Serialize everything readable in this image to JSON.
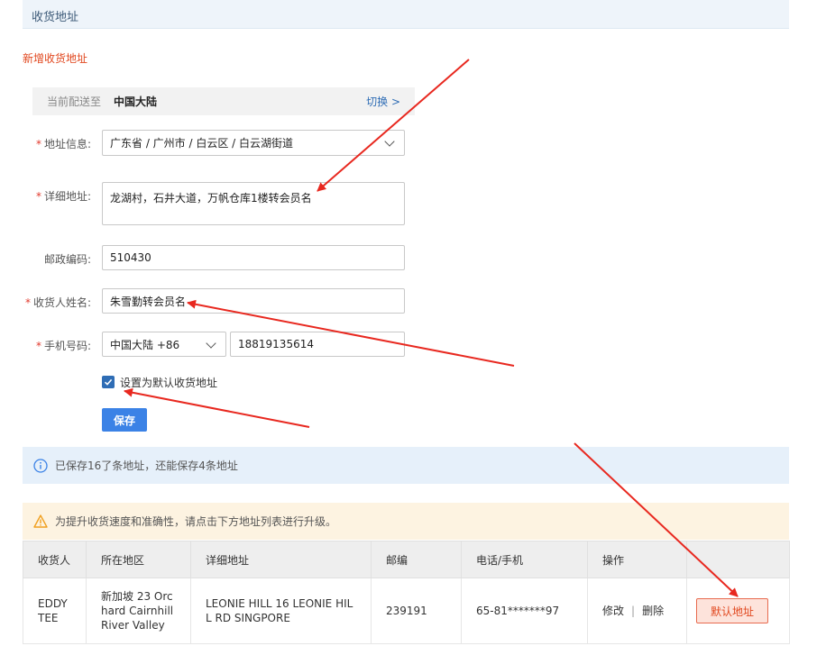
{
  "header": {
    "title": "收货地址"
  },
  "section_title": "新增收货地址",
  "region": {
    "prefix": "当前配送至",
    "value": "中国大陆",
    "switch_label": "切换 >"
  },
  "form": {
    "address_info": {
      "label": "地址信息:",
      "value": "广东省 / 广州市 / 白云区 / 白云湖街道"
    },
    "detail": {
      "label": "详细地址:",
      "value": "龙湖村，石井大道，万帆仓库1楼转会员名"
    },
    "zip": {
      "label": "邮政编码:",
      "value": "510430"
    },
    "name": {
      "label": "收货人姓名:",
      "value": "朱雪勤转会员名"
    },
    "phone": {
      "label": "手机号码:",
      "country": "中国大陆 +86",
      "value": "18819135614"
    },
    "default_checkbox_label": "设置为默认收货地址",
    "save_label": "保存"
  },
  "info_message": "已保存16了条地址，还能保存4条地址",
  "warning_message": "为提升收货速度和准确性，请点击下方地址列表进行升级。",
  "table": {
    "headers": [
      "收货人",
      "所在地区",
      "详细地址",
      "邮编",
      "电话/手机",
      "操作",
      ""
    ],
    "rows": [
      {
        "name": "EDDY TEE",
        "region": "新加坡 23 Orchard Cairnhill River Valley",
        "address": "LEONIE HILL 16 LEONIE HILL RD SINGPORE",
        "zip": "239191",
        "phone": "65-81*******97",
        "edit_label": "修改",
        "separator": "|",
        "delete_label": "删除",
        "default_label": "默认地址"
      }
    ]
  },
  "colors": {
    "accent": "#3b82e6",
    "danger": "#e1471e",
    "annotation": "#e8281f"
  }
}
